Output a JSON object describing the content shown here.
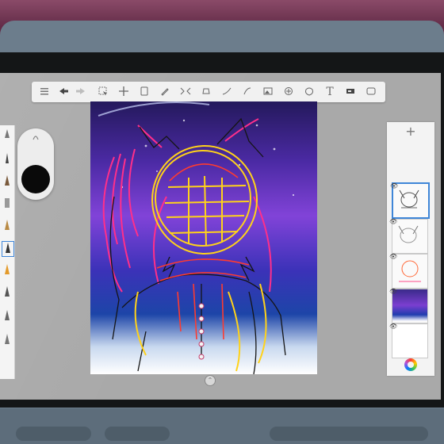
{
  "photo": {
    "scene": "tablet drawing app in a case",
    "colors": {
      "fabric": "#6a2f4c",
      "case": "#6c7d8c",
      "bezel": "#141617",
      "screen_bg": "#a9a9a9",
      "canvas_top": "#2a1b6b",
      "canvas_mid": "#7b3ed0",
      "canvas_low": "#1f3cae",
      "canvas_bottom": "#ffffff",
      "sketch_pink": "#ff2f8a",
      "sketch_yellow": "#ffd21a",
      "sketch_red": "#ff3b2f",
      "selection_blue": "#3f86d8"
    }
  },
  "app": {
    "toolbar": {
      "tools": [
        "gallery-icon",
        "undo-icon",
        "redo-icon",
        "select-icon",
        "transform-icon",
        "layer-icon",
        "brush-icon",
        "symmetry-icon",
        "fill-icon",
        "curve-icon",
        "line-icon",
        "image-icon",
        "ruler-icon",
        "shape-icon",
        "text-icon",
        "fullscreen-icon",
        "cloud-icon"
      ],
      "text_tool_label": "T"
    },
    "layers": {
      "add_label": "+",
      "count": 5,
      "selected_index": 0
    },
    "color_picker_icon": "color-wheel-icon",
    "bottom_handle_icon": "chevron-icon"
  }
}
